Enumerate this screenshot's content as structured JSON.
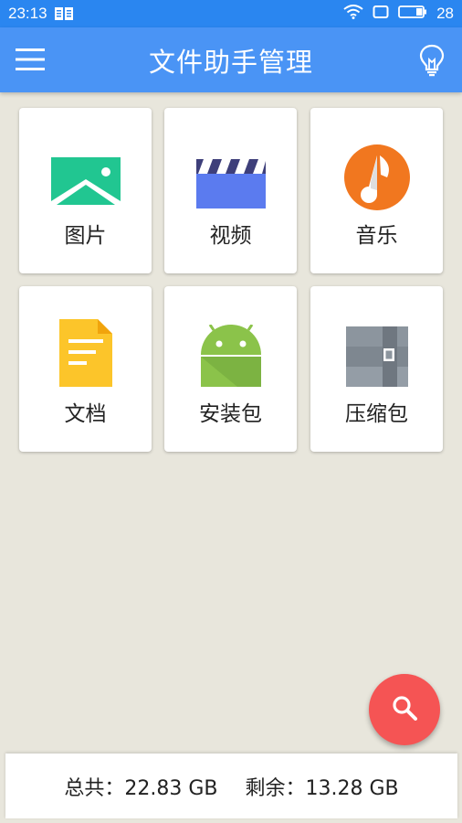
{
  "status_bar": {
    "time": "23:13",
    "battery_level": "28"
  },
  "app_bar": {
    "title": "文件助手管理"
  },
  "categories": [
    {
      "label": "图片",
      "icon": "image-icon"
    },
    {
      "label": "视频",
      "icon": "video-icon"
    },
    {
      "label": "音乐",
      "icon": "music-icon"
    },
    {
      "label": "文档",
      "icon": "document-icon"
    },
    {
      "label": "安装包",
      "icon": "android-icon"
    },
    {
      "label": "压缩包",
      "icon": "archive-icon"
    }
  ],
  "storage": {
    "total_label": "总共：22.83 GB",
    "free_label": "剩余：13.28 GB"
  },
  "colors": {
    "status_bar": "#2a86f0",
    "app_bar": "#4a94f5",
    "background": "#e8e6dc",
    "fab": "#f55454"
  }
}
